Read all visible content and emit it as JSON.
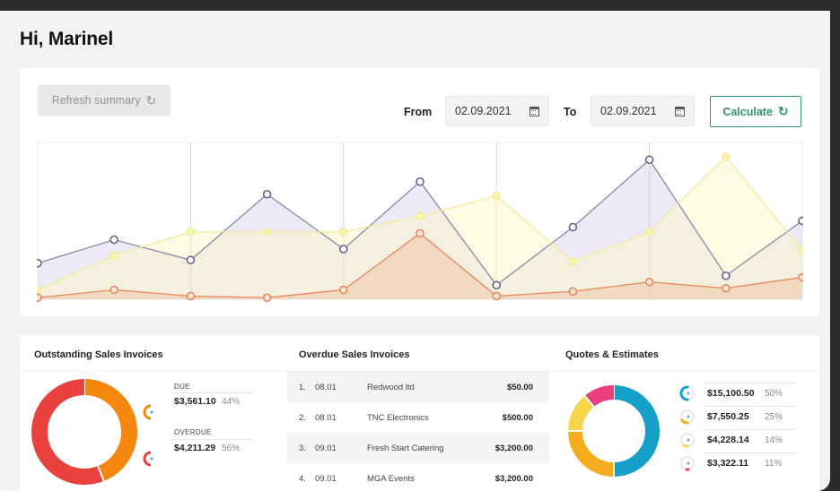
{
  "greeting": "Hi, Marinel",
  "toolbar": {
    "refresh_label": "Refresh summary",
    "refresh_icon": "refresh-icon",
    "from_label": "From",
    "from_value": "02.09.2021",
    "to_label": "To",
    "to_value": "02.09.2021",
    "calendar_icon": "calendar-icon",
    "calculate_label": "Calculate",
    "calculate_icon": "refresh-icon"
  },
  "colors": {
    "accent_green": "#2f9468",
    "series_purple": "#7a6b9a",
    "series_yellow": "#f0e98a",
    "series_orange": "#e8865a",
    "due": "#f5870f",
    "overdue": "#e8413e",
    "q_blue": "#14a0c8",
    "q_orange": "#f7ac1e",
    "q_yellow": "#f9d54a",
    "q_pink": "#eb3f80"
  },
  "chart_data": {
    "type": "area",
    "title": "",
    "xlabel": "",
    "ylabel": "",
    "ylim": [
      0,
      100
    ],
    "x": [
      1,
      2,
      3,
      4,
      5,
      6,
      7,
      8,
      9,
      10,
      11
    ],
    "grid": "vertical lines every 2 points",
    "series": [
      {
        "name": "purple",
        "values": [
          23,
          38,
          25,
          67,
          32,
          75,
          9,
          46,
          89,
          15,
          50
        ]
      },
      {
        "name": "yellow",
        "values": [
          6,
          28,
          43,
          43,
          43,
          53,
          66,
          24,
          43,
          91,
          31
        ]
      },
      {
        "name": "orange",
        "values": [
          1,
          6,
          2,
          1,
          6,
          42,
          2,
          5,
          11,
          7,
          14
        ]
      }
    ]
  },
  "outstanding": {
    "title": "Outstanding Sales Invoices",
    "items": [
      {
        "label": "DUE",
        "amount": "$3,561.10",
        "percent": "44%",
        "value": 44
      },
      {
        "label": "OVERDUE",
        "amount": "$4,211.29",
        "percent": "56%",
        "value": 56
      }
    ]
  },
  "overdue": {
    "title": "Overdue Sales Invoices",
    "rows": [
      {
        "num": "1.",
        "date": "08.01",
        "customer": "Redwood ltd",
        "amount": "$50.00"
      },
      {
        "num": "2.",
        "date": "08.01",
        "customer": "TNC Electronics",
        "amount": "$500.00"
      },
      {
        "num": "3.",
        "date": "09.01",
        "customer": "Fresh Start Catering",
        "amount": "$3,200.00"
      },
      {
        "num": "4.",
        "date": "09.01",
        "customer": "MGA Events",
        "amount": "$3,200.00"
      }
    ]
  },
  "quotes": {
    "title": "Quotes & Estimates",
    "items": [
      {
        "amount": "$15,100.50",
        "percent": "50%",
        "value": 50
      },
      {
        "amount": "$7,550.25",
        "percent": "25%",
        "value": 25
      },
      {
        "amount": "$4,228.14",
        "percent": "14%",
        "value": 14
      },
      {
        "amount": "$3,322.11",
        "percent": "11%",
        "value": 11
      }
    ]
  }
}
